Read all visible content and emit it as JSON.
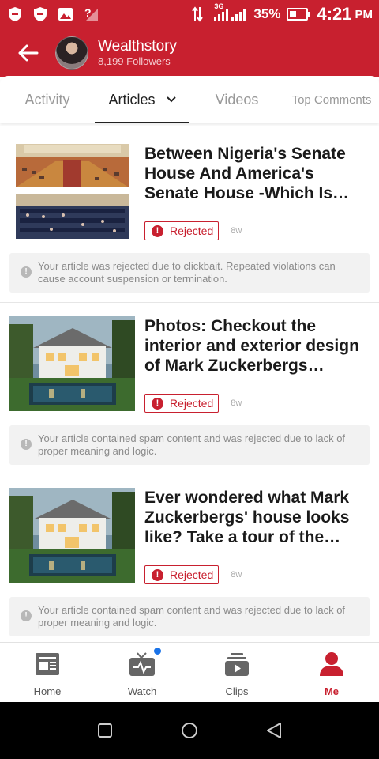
{
  "status_bar": {
    "network": "3G",
    "battery": "35%",
    "time": "4:21",
    "ampm": "PM"
  },
  "header": {
    "name": "Wealthstory",
    "followers": "8,199 Followers"
  },
  "tabs": [
    {
      "label": "Activity"
    },
    {
      "label": "Articles"
    },
    {
      "label": "Videos"
    },
    {
      "label": "Top Comments"
    }
  ],
  "articles": [
    {
      "title": "Between Nigeria's Senate House And America's Senate House -Which Is More Bea...",
      "status": "Rejected",
      "age": "8w",
      "notice": "Your article was rejected due to clickbait. Repeated violations can cause account suspension or termination."
    },
    {
      "title": "Photos: Checkout the interior and exterior design of Mark Zuckerbergs house...",
      "status": "Rejected",
      "age": "8w",
      "notice": "Your article contained spam content and was rejected due to lack of proper meaning and logic."
    },
    {
      "title": "Ever wondered what Mark Zuckerbergs' house looks like? Take a tour of the Mar...",
      "status": "Rejected",
      "age": "8w",
      "notice": "Your article contained spam content and was rejected due to lack of proper meaning and logic."
    }
  ],
  "bottom_nav": [
    {
      "label": "Home",
      "icon": "newspaper-icon"
    },
    {
      "label": "Watch",
      "icon": "tv-icon"
    },
    {
      "label": "Clips",
      "icon": "clips-icon"
    },
    {
      "label": "Me",
      "icon": "person-icon"
    }
  ],
  "colors": {
    "brand": "#c8202f",
    "notification_dot": "#1a73e8"
  }
}
